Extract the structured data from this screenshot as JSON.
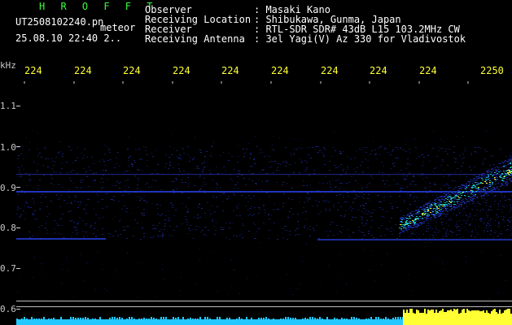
{
  "header": {
    "title": "H R O F F T",
    "filename": "UT2508102240.pn",
    "sublabel": "meteor",
    "datetime": "25.08.10 22:40     2.."
  },
  "info": {
    "labels": [
      "Observer",
      "Receiving Location",
      "Receiver",
      "Receiving Antenna"
    ],
    "values": [
      ": Masaki Kano",
      ": Shibukawa, Gunma, Japan",
      ": RTL-SDR SDR# 43dB L15 103.2MHz CW",
      ": 3el Yagi(V) Az 330 for Vladivostok"
    ]
  },
  "axis": {
    "y_unit": "kHz",
    "x_ticks": [
      "224",
      "224",
      "224",
      "224",
      "224",
      "224",
      "224",
      "224",
      "224",
      "2250"
    ],
    "y_ticks": [
      "1.1",
      "1.0",
      "0.9",
      "0.8",
      "0.7",
      "0.6"
    ]
  },
  "colors": {
    "header_title": "#39ff39",
    "axis_ticks": "#ffff33",
    "signal_low": "#1a2a9a",
    "signal_mid": "#19d0c8",
    "signal_high": "#ffff33",
    "bottom_bar": "#22c8ff"
  }
}
